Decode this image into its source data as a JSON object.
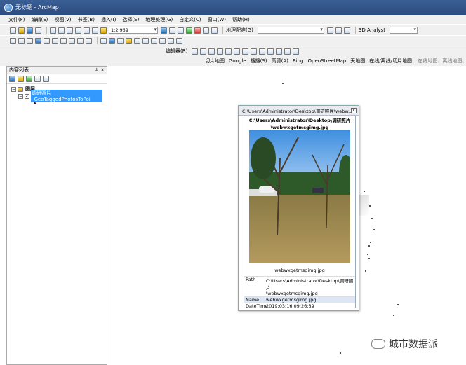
{
  "app": {
    "title": "无标题 - ArcMap"
  },
  "menu": [
    "文件(F)",
    "编辑(E)",
    "视图(V)",
    "书签(B)",
    "插入(I)",
    "选择(S)",
    "地理处理(G)",
    "自定义(C)",
    "窗口(W)",
    "帮助(H)"
  ],
  "toolbar": {
    "scale": "1:2,959",
    "georef": "地理配准(G)",
    "analyst": "3D Analyst",
    "editor": "编辑器(R)"
  },
  "toolbar3": {
    "items": [
      "切片地图",
      "Google",
      "搜搜(S)",
      "高德(A)",
      "Bing",
      "OpenStreetMap",
      "天地图"
    ],
    "online": "在线/离线/切片地图:",
    "online_desc": "在线地图、离线地图、切片"
  },
  "toc": {
    "title": "内容列表",
    "pin": "↓ ×",
    "layers_label": "图层",
    "layer_name": "调研照片_GeoTaggedPhotosToPoi"
  },
  "popup": {
    "header": "C:\\Users\\Administrator\\Desktop\\调研照片\\webw...",
    "caption_line1": "C:\\Users\\Administrator\\Desktop\\调研照片",
    "caption_line2": "\\webwxgetmsgimg.jpg",
    "filename": "webwxgetmsgimg.jpg",
    "attrs": [
      {
        "key": "Path",
        "value1": "C:\\Users\\Administrator\\Desktop\\调研照片",
        "value2": "\\webwxgetmsgimg.jpg"
      },
      {
        "key": "Name",
        "value1": "webwxgetmsgimg.jpg"
      },
      {
        "key": "DateTime",
        "value1": "2019:03:16 09:26:39"
      }
    ]
  },
  "watermark": {
    "text": "城市数据派"
  }
}
